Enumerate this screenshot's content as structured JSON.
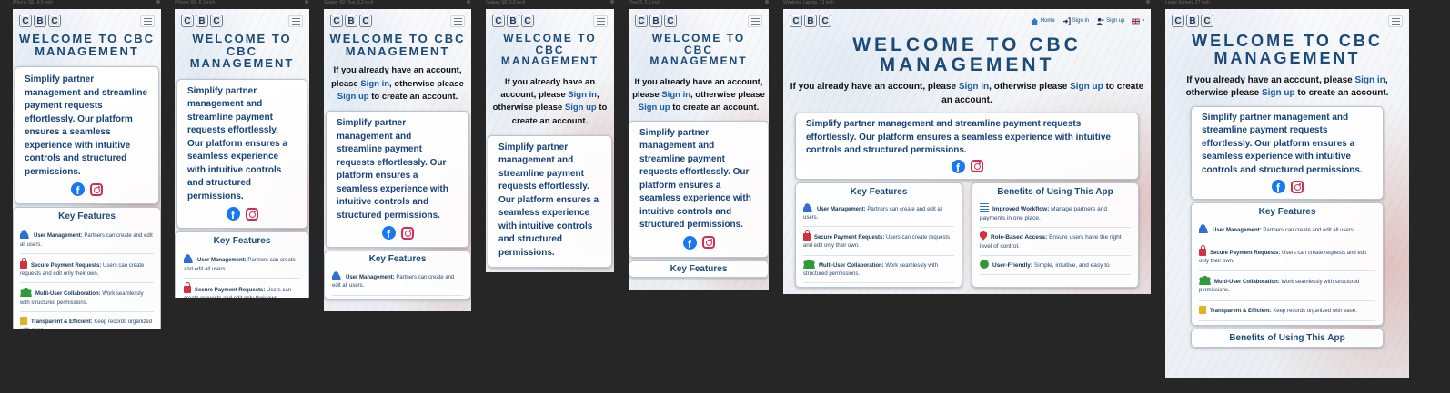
{
  "brand": {
    "logo_letters": [
      "C",
      "B",
      "C"
    ],
    "title": "WELCOME TO CBC MANAGEMENT",
    "title_color": "#1c4a78",
    "link_color": "#1a5aa6"
  },
  "device_labels": [
    "iPhone SE, 4.0 inch",
    "iPhone XR, 6.1 inch",
    "Galaxy S9 Plus, 6.2 inch",
    "Galaxy S8, 5.8 inch",
    "Pixel 3, 5.5 inch",
    "Windows Laptop, 13 inch",
    "Large Screen, 27 inch"
  ],
  "nav": {
    "home": "Home",
    "signin": "Sign in",
    "signup": "Sign up"
  },
  "intro": {
    "prefix": "If you already have an account, please",
    "signin": "Sign in",
    "middle": ", otherwise please",
    "signup": "Sign up",
    "suffix": "to create an account."
  },
  "description": "Simplify partner management and streamline payment requests effortlessly. Our platform ensures a seamless experience with intuitive controls and structured permissions.",
  "social": {
    "facebook": "f"
  },
  "key_features": {
    "title": "Key Features",
    "items": [
      {
        "icon": "user-icon",
        "name": "User Management:",
        "text": "Partners can create and edit all users."
      },
      {
        "icon": "lock-icon",
        "name": "Secure Payment Requests:",
        "text": "Users can create requests and edit only their own."
      },
      {
        "icon": "group-icon",
        "name": "Multi-User Collaboration:",
        "text": "Work seamlessly with structured permissions."
      },
      {
        "icon": "box-icon",
        "name": "Transparent & Efficient:",
        "text": "Keep records organized with ease."
      }
    ]
  },
  "benefits": {
    "title": "Benefits of Using This App",
    "items": [
      {
        "icon": "list-icon",
        "name": "Improved Workflow:",
        "text": "Manage partners and payments in one place."
      },
      {
        "icon": "shield-icon",
        "name": "Role-Based Access:",
        "text": "Ensure users have the right level of control."
      },
      {
        "icon": "smile-icon",
        "name": "User-Friendly:",
        "text": "Simple, intuitive, and easy to"
      }
    ]
  }
}
